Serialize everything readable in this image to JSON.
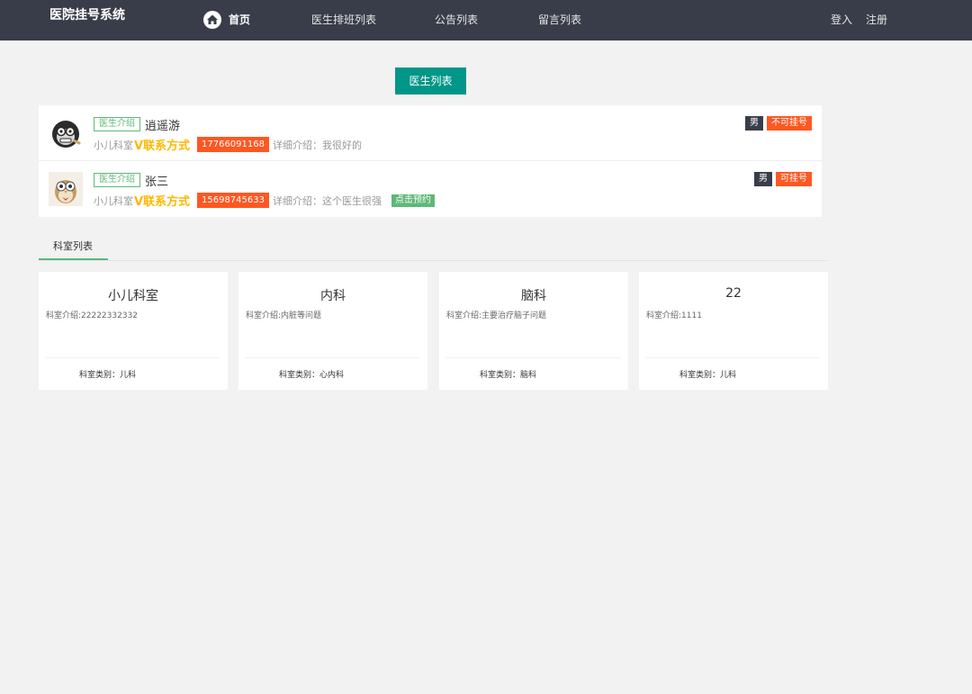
{
  "header": {
    "brand": "医院挂号系统",
    "nav": {
      "home": "首页",
      "schedule": "医生排班列表",
      "notice": "公告列表",
      "message": "留言列表"
    },
    "login": "登入",
    "register": "注册",
    "background": "#393d49"
  },
  "doctor_list_button": "医生列表",
  "doctors": [
    {
      "intro_tag": "医生介绍",
      "name": "逍遥游",
      "department": "小儿科室",
      "contact_label": "V联系方式",
      "phone": "17766091168",
      "detail": "详细介绍：我很好的",
      "gender": "男",
      "status": "不可挂号"
    },
    {
      "intro_tag": "医生介绍",
      "name": "张三",
      "department": "小儿科室",
      "contact_label": "V联系方式",
      "phone": "15698745633",
      "detail": "详细介绍：这个医生很强",
      "book": "点击预约",
      "gender": "男",
      "status": "可挂号"
    }
  ],
  "department_tab": "科室列表",
  "departments": [
    {
      "title": "小儿科室",
      "intro": "科室介绍:22222332332",
      "type": "科室类别：儿科"
    },
    {
      "title": "内科",
      "intro": "科室介绍:内脏等问题",
      "type": "科室类别：心内科"
    },
    {
      "title": "脑科",
      "intro": "科室介绍:主要治疗脑子问题",
      "type": "科室类别：脑科"
    },
    {
      "title": "22",
      "intro": "科室介绍:1111",
      "type": "科室类别：儿科"
    }
  ],
  "colors": {
    "accent": "#009688",
    "green": "#5fb878",
    "orange": "#ff5722",
    "gold": "#ffb800"
  }
}
